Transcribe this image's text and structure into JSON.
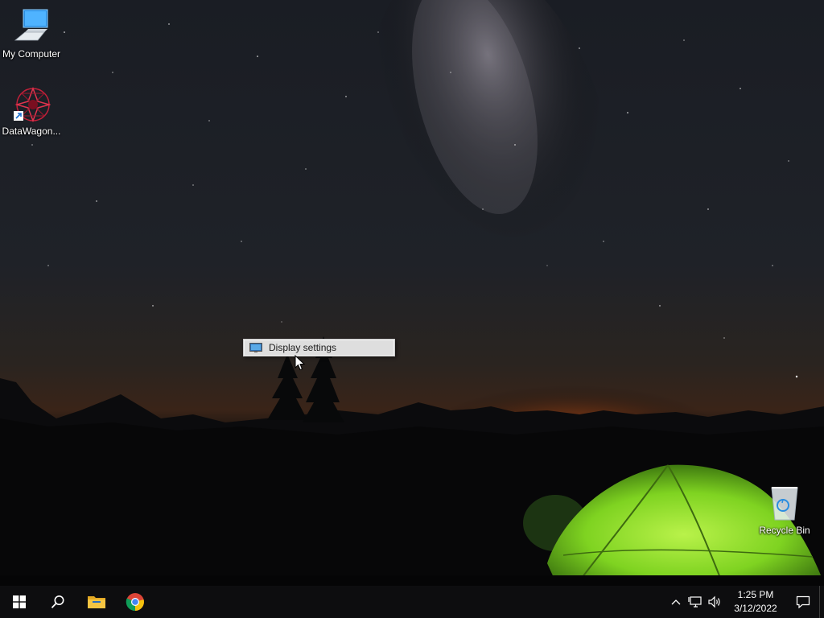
{
  "desktop": {
    "icons": [
      {
        "label": "My Computer",
        "icon": "computer-icon"
      },
      {
        "label": "DataWagon...",
        "icon": "datawagon-icon"
      },
      {
        "label": "Recycle Bin",
        "icon": "recycle-bin-icon"
      }
    ]
  },
  "context_menu": {
    "items": [
      {
        "label": "Display settings",
        "icon": "display-icon"
      }
    ]
  },
  "taskbar": {
    "pinned": [
      {
        "name": "start",
        "icon": "windows-logo-icon"
      },
      {
        "name": "search",
        "icon": "search-icon"
      },
      {
        "name": "file-explorer",
        "icon": "folder-icon"
      },
      {
        "name": "chrome",
        "icon": "chrome-icon"
      }
    ],
    "tray": {
      "icons": [
        "chevron-up-icon",
        "network-icon",
        "volume-icon"
      ],
      "time": "1:25 PM",
      "date": "3/12/2022",
      "notification_icon": "action-center-icon"
    }
  },
  "colors": {
    "taskbar_bg": "#0d0d0f",
    "menu_bg": "#f0f0f0",
    "menu_hover": "#dedede",
    "tent_green": "#7fd321",
    "horizon_glow": "#e0641c"
  }
}
